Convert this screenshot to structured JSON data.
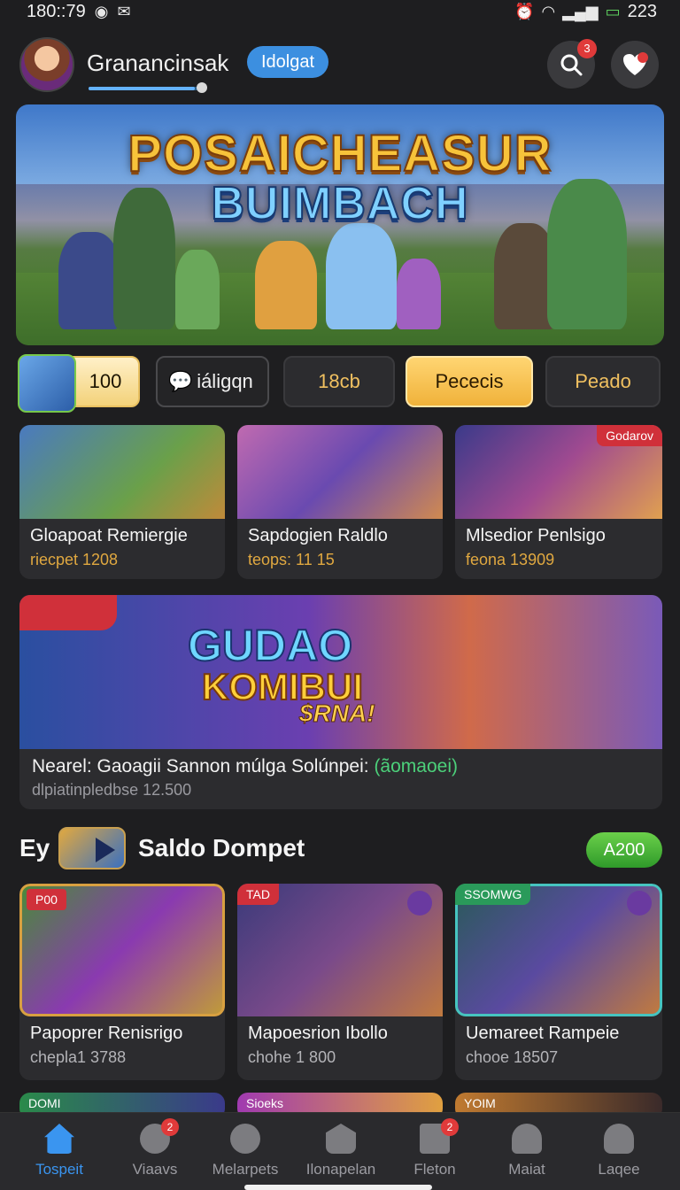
{
  "status": {
    "time": "180::79",
    "battery": "223"
  },
  "header": {
    "username": "Granancinsak",
    "tag": "Idolgat",
    "search_badge": "3"
  },
  "hero": {
    "line1": "POSAICHEASUR",
    "line2": "BUIMBACH"
  },
  "chips": [
    {
      "label": "100"
    },
    {
      "label": "iáligqn"
    },
    {
      "label": "18cb"
    },
    {
      "label": "Pececis"
    },
    {
      "label": "Peado"
    }
  ],
  "cards_row1": [
    {
      "title": "Gloapoat Remiergie",
      "sub": "riecpet 1208",
      "ribbon": ""
    },
    {
      "title": "Sapdogien Raldlo",
      "sub": "teops: 11 15",
      "ribbon": ""
    },
    {
      "title": "Mlsedior Penlsigo",
      "sub": "feona 13909",
      "ribbon": "Godarov"
    }
  ],
  "banner": {
    "line1": "GUDAO",
    "line2": "KOMIBUI",
    "line3": "$RNA!",
    "title": "Nearel: Gaoagii Sannon múlga Solúnpei:",
    "link": "(ãomaoei)",
    "sub": "dlpiatinpledbse 12.500"
  },
  "section": {
    "prefix": "Ey",
    "title": "Saldo Dompet",
    "pill": "A200"
  },
  "cards_row2": [
    {
      "title": "Papoprer Renisrigo",
      "sub": "chepla1 3788",
      "ribbon": "P00"
    },
    {
      "title": "Mapoesrion Ibollo",
      "sub": "chohe 1 800",
      "ribbon": "TAD"
    },
    {
      "title": "Uemareet Rampeie",
      "sub": "chooe 18507",
      "ribbon": "SSOMWG"
    }
  ],
  "cards_row3": [
    {
      "ribbon": "DOMI"
    },
    {
      "ribbon": "Sioeks"
    },
    {
      "ribbon": "YOIM"
    }
  ],
  "nav": [
    {
      "label": "Tospeit",
      "badge": ""
    },
    {
      "label": "Viaavs",
      "badge": "2"
    },
    {
      "label": "Melarpets",
      "badge": ""
    },
    {
      "label": "Ilonapelan",
      "badge": ""
    },
    {
      "label": "Fleton",
      "badge": "2"
    },
    {
      "label": "Maiat",
      "badge": ""
    },
    {
      "label": "Laqee",
      "badge": ""
    }
  ],
  "colors": {
    "accent": "#3a95f0",
    "gold": "#f0b23a",
    "sale": "#6bd04a"
  }
}
